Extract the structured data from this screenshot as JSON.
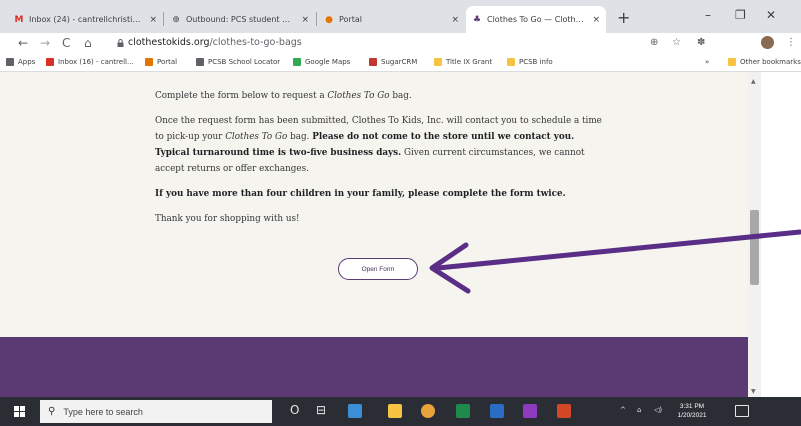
{
  "browser": {
    "tabs": [
      {
        "label": "Inbox (24) - cantrellchristine@",
        "favicon": "gmail-icon",
        "color": "#d93025",
        "glyph": "M",
        "active": false
      },
      {
        "label": "Outbound: PCS student & staff",
        "favicon": "web-icon",
        "color": "#5f6368",
        "glyph": "⊕",
        "active": false
      },
      {
        "label": "Portal",
        "favicon": "portal-icon",
        "color": "#e37400",
        "glyph": "●",
        "active": false
      },
      {
        "label": "Clothes To Go — Clothes To",
        "favicon": "clothes-to-kids-icon",
        "color": "#5b3a73",
        "glyph": "♣",
        "active": true
      }
    ],
    "close_glyph": "×",
    "new_tab_glyph": "+",
    "window_controls": {
      "minimize": "–",
      "maximize": "❐",
      "close": "✕"
    },
    "nav": {
      "back": "←",
      "forward": "→",
      "reload": "C",
      "home": "⌂"
    },
    "url": {
      "domain": "clothestokids.org",
      "path": "/clothes-to-go-bags"
    },
    "toolbar_icons": {
      "zoom": "⊕",
      "star": "☆",
      "extensions": "✽",
      "menu": "⋮"
    },
    "bookmarks": [
      {
        "label": "Apps",
        "color": "#5f6368"
      },
      {
        "label": "Inbox (16) - cantrell...",
        "color": "#d93025"
      },
      {
        "label": "Portal",
        "color": "#e37400"
      },
      {
        "label": "PCSB School Locator",
        "color": "#5f6368"
      },
      {
        "label": "Google Maps",
        "color": "#34a853"
      },
      {
        "label": "SugarCRM",
        "color": "#c0392b"
      },
      {
        "label": "Title IX Grant",
        "color": "#f6c343"
      },
      {
        "label": "PCSB info",
        "color": "#f6c343"
      }
    ],
    "bookmarks_more": "»",
    "other_bookmarks": "Other bookmarks"
  },
  "page": {
    "p1_before": "Complete the form below to request a ",
    "p1_em": "Clothes To Go",
    "p1_after": " bag.",
    "p2_a": "Once the request form has been submitted, Clothes To Kids, Inc. will contact you to schedule a time to pick-up your ",
    "p2_em": "Clothes To Go",
    "p2_b": " bag. ",
    "p2_bold": "Please do not come to the store until we contact you. Typical turnaround time is two-five business days.",
    "p2_c": " Given current circumstances, we cannot accept returns or offer exchanges.",
    "p3_bold": "If you have more than four children in your family, please complete the form twice.",
    "p4": "Thank you for shopping with us!",
    "open_button": "Open Form",
    "footer_color": "#5b3a73"
  },
  "taskbar": {
    "search_placeholder": "Type here to search",
    "clock_time": "3:31 PM",
    "clock_date": "1/20/2021",
    "tray": {
      "chevron": "^",
      "network": "⌂",
      "volume": "◁)"
    },
    "pinned": [
      {
        "name": "cortana-icon",
        "glyph": "O"
      },
      {
        "name": "task-view-icon",
        "glyph": "⊟"
      }
    ],
    "apps": [
      {
        "name": "people-icon",
        "color": "#3a8fd6"
      },
      {
        "name": "file-explorer-icon",
        "color": "#f6c343"
      },
      {
        "name": "chrome-icon",
        "color": "#e8a33a"
      },
      {
        "name": "excel-icon",
        "color": "#1f8a4c"
      },
      {
        "name": "word-icon",
        "color": "#2b6cc4"
      },
      {
        "name": "onenote-icon",
        "color": "#8e3bbf"
      },
      {
        "name": "powerpoint-icon",
        "color": "#d24726"
      }
    ]
  }
}
